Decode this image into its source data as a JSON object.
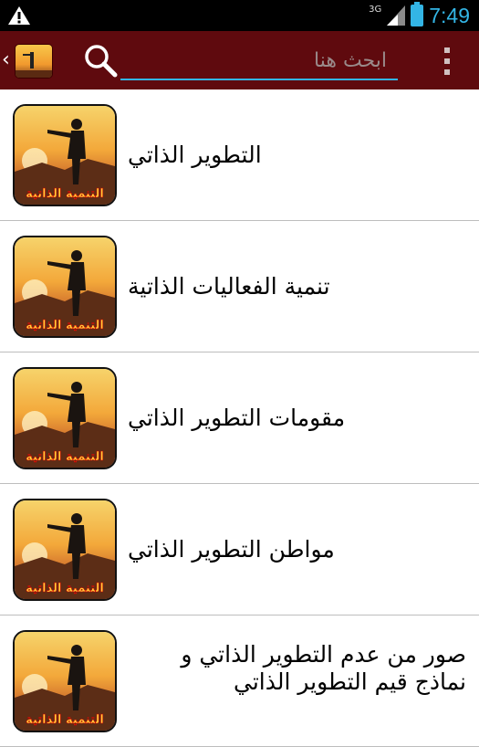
{
  "status_bar": {
    "network": "3G",
    "time": "7:49",
    "icons": [
      "warning-icon",
      "signal-icon",
      "battery-icon"
    ]
  },
  "action_bar": {
    "up_icon": "chevron-left-icon",
    "search_placeholder": "ابحث هنا",
    "search_value": "",
    "icons": [
      "app-icon",
      "search-icon",
      "overflow-menu-icon"
    ],
    "background_color": "#5f0a0e",
    "accent_color": "#33b5e5"
  },
  "thumbnail_caption": "التنمية الذاتية",
  "items": [
    {
      "title": "التطوير الذاتي"
    },
    {
      "title": "تنمية الفعاليات الذاتية"
    },
    {
      "title": "مقومات التطوير الذاتي"
    },
    {
      "title": "مواطن التطوير الذاتي"
    },
    {
      "title_line1": "صور من عدم التطوير الذاتي و",
      "title_line2": "نماذج قيم التطوير الذاتي"
    }
  ]
}
